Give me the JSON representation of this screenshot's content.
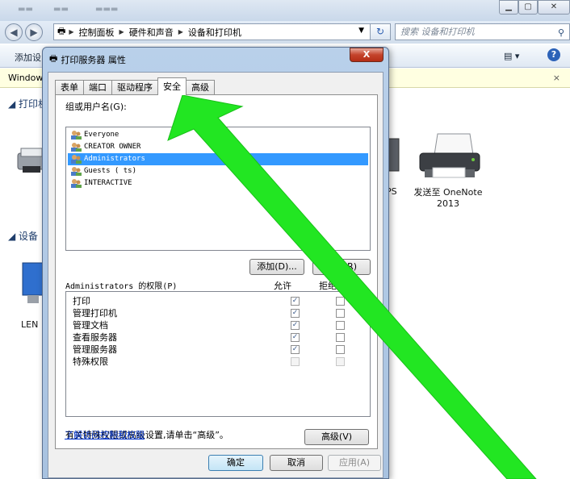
{
  "explorer": {
    "breadcrumb": [
      "控制面板",
      "硬件和声音",
      "设备和打印机"
    ],
    "search_placeholder": "搜索 设备和打印机",
    "cmd_add": "添加设",
    "infobar_text": "Window",
    "section_printers": "打印机",
    "section_devices": "设备",
    "device_onenote": "发送至 OneNote 2013",
    "device_xps_fragment": "PS",
    "device_len": "LEN"
  },
  "dialog": {
    "title": "打印服务器 属性",
    "close_label": "X",
    "tabs": [
      {
        "label": "表单"
      },
      {
        "label": "端口"
      },
      {
        "label": "驱动程序"
      },
      {
        "label": "安全",
        "active": true
      },
      {
        "label": "高级"
      }
    ],
    "groups_label": "组或用户名(G):",
    "users": [
      {
        "name": "Everyone"
      },
      {
        "name": "CREATOR OWNER"
      },
      {
        "name": "Administrators",
        "selected": true
      },
      {
        "name": "Guests (                ts)"
      },
      {
        "name": "INTERACTIVE"
      }
    ],
    "add_button": "添加(D)...",
    "remove_button": "删除(R)",
    "perm_label": "Administrators 的权限(P)",
    "allow_header": "允许",
    "deny_header": "拒绝",
    "permissions": [
      {
        "name": "打印",
        "allow": true,
        "deny": false,
        "disabled": false
      },
      {
        "name": "管理打印机",
        "allow": true,
        "deny": false,
        "disabled": false
      },
      {
        "name": "管理文档",
        "allow": true,
        "deny": false,
        "disabled": false
      },
      {
        "name": "查看服务器",
        "allow": true,
        "deny": false,
        "disabled": false
      },
      {
        "name": "管理服务器",
        "allow": true,
        "deny": false,
        "disabled": false
      },
      {
        "name": "特殊权限",
        "allow": false,
        "deny": false,
        "disabled": true
      }
    ],
    "special_note": "有关特殊权限或高级设置,请单击“高级”。",
    "advanced_button": "高级(V)",
    "learn_link": "了解访问控制和权限",
    "ok_button": "确定",
    "cancel_button": "取消",
    "apply_button": "应用(A)"
  },
  "colors": {
    "arrow": "#22e622",
    "selection": "#3399ff",
    "link": "#0033cc"
  }
}
